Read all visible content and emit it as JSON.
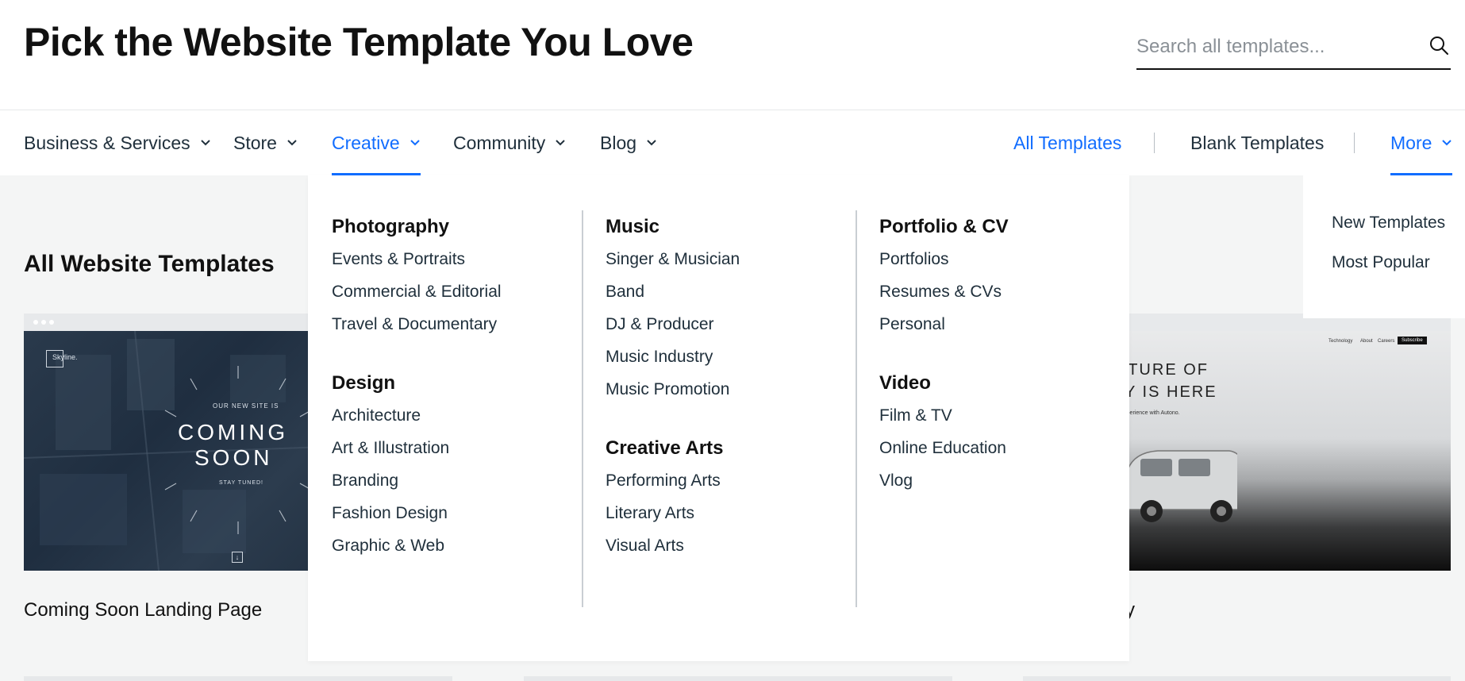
{
  "header": {
    "title": "Pick the Website Template You Love",
    "search_placeholder": "Search all templates...",
    "search_value": ""
  },
  "nav": {
    "items": [
      {
        "label": "Business & Services"
      },
      {
        "label": "Store"
      },
      {
        "label": "Creative"
      },
      {
        "label": "Community"
      },
      {
        "label": "Blog"
      }
    ],
    "active": "Creative",
    "all_templates": "All Templates",
    "blank_templates": "Blank Templates",
    "more": "More"
  },
  "mega_menu": {
    "photography": {
      "heading": "Photography",
      "links": [
        "Events & Portraits",
        "Commercial & Editorial",
        "Travel & Documentary"
      ]
    },
    "design": {
      "heading": "Design",
      "links": [
        "Architecture",
        "Art & Illustration",
        "Branding",
        "Fashion Design",
        "Graphic & Web"
      ]
    },
    "music": {
      "heading": "Music",
      "links": [
        "Singer & Musician",
        "Band",
        "DJ & Producer",
        "Music Industry",
        "Music Promotion"
      ]
    },
    "creative_arts": {
      "heading": "Creative Arts",
      "links": [
        "Performing Arts",
        "Literary Arts",
        "Visual Arts"
      ]
    },
    "portfolio_cv": {
      "heading": "Portfolio & CV",
      "links": [
        "Portfolios",
        "Resumes & CVs",
        "Personal"
      ]
    },
    "video": {
      "heading": "Video",
      "links": [
        "Film & TV",
        "Online Education",
        "Vlog"
      ]
    }
  },
  "more_menu": {
    "items": [
      "New Templates",
      "Most Popular"
    ]
  },
  "main": {
    "section_title": "All Website Templates",
    "cards": [
      {
        "title": "Coming Soon Landing Page",
        "thumb": {
          "logo": "Skyline.",
          "overline": "OUR NEW SITE IS",
          "headline_1": "COMING",
          "headline_2": "SOON",
          "tagline": "STAY TUNED!"
        }
      },
      {
        "title": "y",
        "thumb": {
          "nav": [
            "Technology",
            "About",
            "Careers"
          ],
          "subscribe": "Subscribe",
          "headline_1": "THE FUTURE OF",
          "headline_2": "MOBILITY IS HERE",
          "subline": "Discover the safest self-driving experience with Autono."
        }
      }
    ]
  },
  "colors": {
    "accent": "#116dff",
    "text": "#20303c",
    "background": "#f4f5f5"
  },
  "icons": {
    "search": "search-icon",
    "chevron": "chevron-down-icon"
  }
}
